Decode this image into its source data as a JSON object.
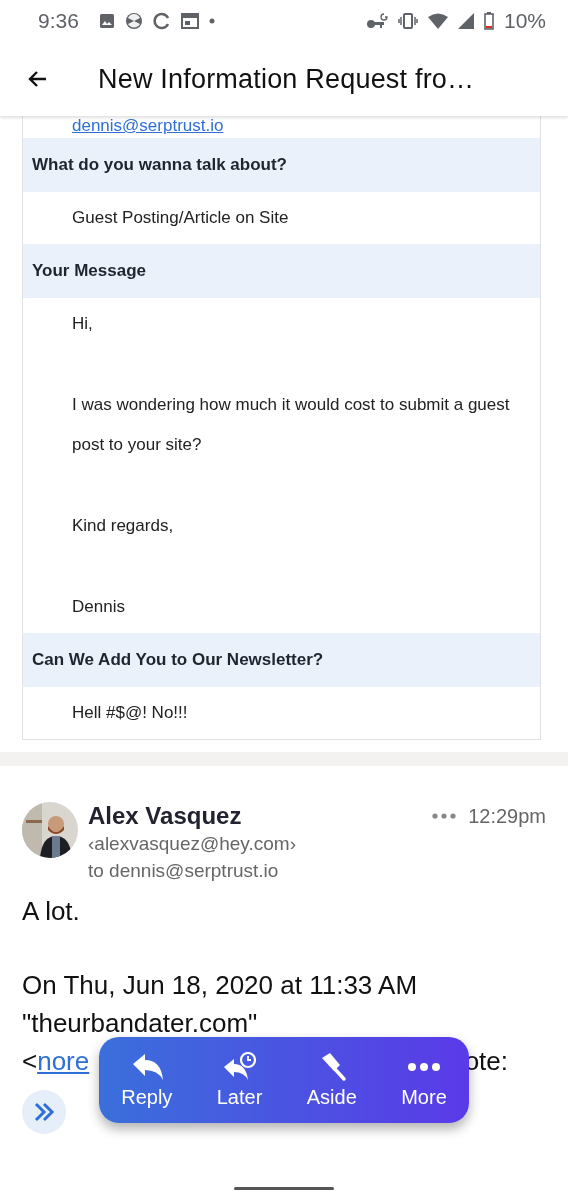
{
  "status_bar": {
    "time": "9:36",
    "battery": "10%"
  },
  "app_bar": {
    "title": "New Information Request fro…"
  },
  "form": {
    "link": "dennis@serptrust.io",
    "fields": [
      {
        "label": "What do you wanna talk about?",
        "lines": [
          "Guest Posting/Article on Site"
        ]
      },
      {
        "label": "Your Message",
        "lines": [
          "Hi,",
          "I was wondering how much it would cost to submit a guest post to your site?",
          "Kind regards,",
          "Dennis"
        ]
      },
      {
        "label": "Can We Add You to Our Newsletter?",
        "lines": [
          "Hell #$@! No!!!"
        ]
      }
    ]
  },
  "message": {
    "sender": "Alex Vasquez",
    "email": "‹alexvasquez@hey.com›",
    "to": "to dennis@serptrust.io",
    "time": "12:29pm",
    "body": [
      "A lot.",
      "On Thu, Jun 18, 2020 at 11:33 AM",
      "\"theurbandater.com\""
    ],
    "quote_start": "<",
    "quote_link": "nore",
    "quote_end": "ote:"
  },
  "action_bar": [
    {
      "kind": "reply",
      "label": "Reply"
    },
    {
      "kind": "later",
      "label": "Later"
    },
    {
      "kind": "aside",
      "label": "Aside"
    },
    {
      "kind": "more",
      "label": "More"
    }
  ]
}
